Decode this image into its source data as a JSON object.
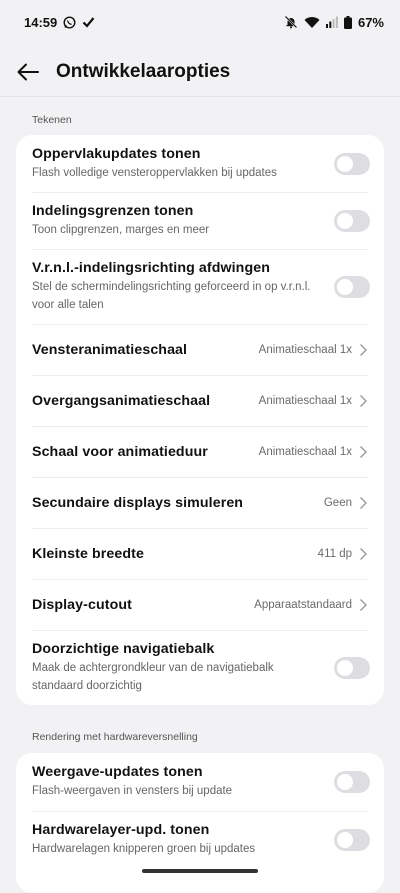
{
  "status": {
    "time": "14:59",
    "battery": "67%"
  },
  "header": {
    "title": "Ontwikkelaaropties"
  },
  "sections": [
    {
      "label": "Tekenen",
      "rows": [
        {
          "title": "Oppervlakupdates tonen",
          "subtitle": "Flash volledige vensteroppervlakken bij updates",
          "toggle": false
        },
        {
          "title": "Indelingsgrenzen tonen",
          "subtitle": "Toon clipgrenzen, marges en meer",
          "toggle": false
        },
        {
          "title": "V.r.n.l.-indelingsrichting afdwingen",
          "subtitle": "Stel de schermindelingsrichting geforceerd in op v.r.n.l. voor alle talen",
          "toggle": false
        },
        {
          "title": "Vensteranimatieschaal",
          "value": "Animatieschaal 1x"
        },
        {
          "title": "Overgangsanimatieschaal",
          "value": "Animatieschaal 1x"
        },
        {
          "title": "Schaal voor animatieduur",
          "value": "Animatieschaal 1x"
        },
        {
          "title": "Secundaire displays simuleren",
          "value": "Geen"
        },
        {
          "title": "Kleinste breedte",
          "value": "411 dp"
        },
        {
          "title": "Display-cutout",
          "value": "Apparaatstandaard"
        },
        {
          "title": "Doorzichtige navigatiebalk",
          "subtitle": "Maak de achtergrondkleur van de navigatiebalk standaard doorzichtig",
          "toggle": false
        }
      ]
    },
    {
      "label": "Rendering met hardwareversnelling",
      "rows": [
        {
          "title": "Weergave-updates tonen",
          "subtitle": "Flash-weergaven in vensters bij update",
          "toggle": false
        },
        {
          "title": "Hardwarelayer-upd. tonen",
          "subtitle": "Hardwarelagen knipperen groen bij updates",
          "toggle": false
        }
      ]
    }
  ]
}
